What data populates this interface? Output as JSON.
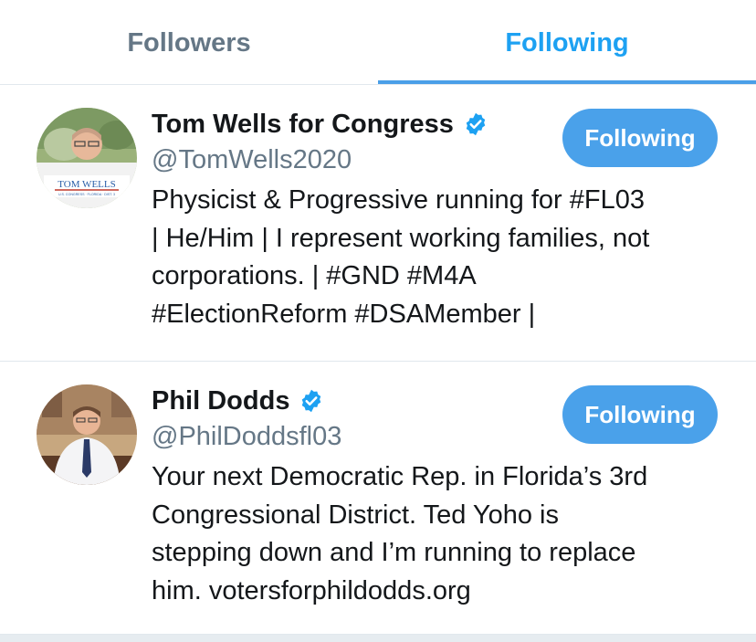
{
  "tabs": {
    "followers_label": "Followers",
    "following_label": "Following",
    "active": "Following"
  },
  "accent_color": "#1da1f2",
  "button_color": "#4aa1ea",
  "users": [
    {
      "name": "Tom Wells for Congress",
      "handle": "@TomWells2020",
      "verified": true,
      "avatar_icon": "profile-photo-icon",
      "avatar_logo_text": "TOM WELLS",
      "avatar_logo_subtext": "U.S. CONGRESS · FLORIDA · DIST. 3",
      "button_label": "Following",
      "bio_lines": [
        "Physicist & Progressive running for #FL03",
        "| He/Him | I represent working families, not",
        "corporations. | #GND #M4A",
        "#ElectionReform #DSAMember |"
      ]
    },
    {
      "name": "Phil Dodds",
      "handle": "@PhilDoddsfl03",
      "verified": true,
      "avatar_icon": "profile-photo-icon",
      "button_label": "Following",
      "bio_lines": [
        "Your next Democratic Rep. in Florida’s 3rd",
        "Congressional District. Ted Yoho is",
        "stepping down and I’m running to replace",
        "him. votersforphildodds.org"
      ]
    }
  ]
}
